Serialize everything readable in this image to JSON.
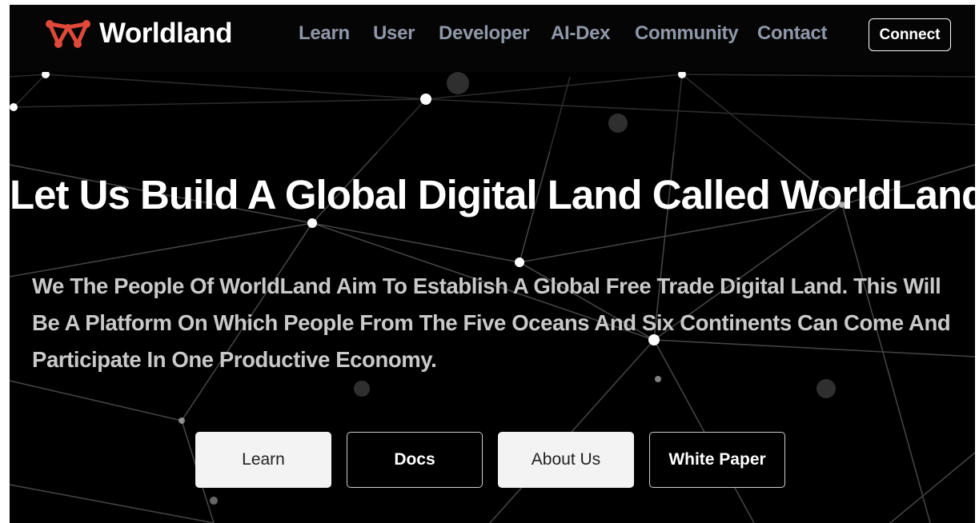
{
  "brand": {
    "name": "Worldland",
    "logo_icon": "worldland-w-logo-icon",
    "accent": "#e0493a"
  },
  "nav": {
    "links": [
      "Learn",
      "User",
      "Developer",
      "AI-Dex",
      "Community",
      "Contact"
    ],
    "connect_label": "Connect"
  },
  "hero": {
    "title": "Let Us Build A Global Digital Land Called WorldLand.",
    "description": "We The People Of WorldLand Aim To Establish A Global Free Trade Digital Land. This Will Be A Platform On Which People From The Five Oceans And Six Continents Can Come And Participate In One Productive Economy.",
    "buttons": [
      "Learn",
      "Docs",
      "About Us",
      "White Paper"
    ]
  },
  "colors": {
    "background": "#000000",
    "nav_text": "#8f98a8",
    "body_text": "#c9c9c9"
  }
}
